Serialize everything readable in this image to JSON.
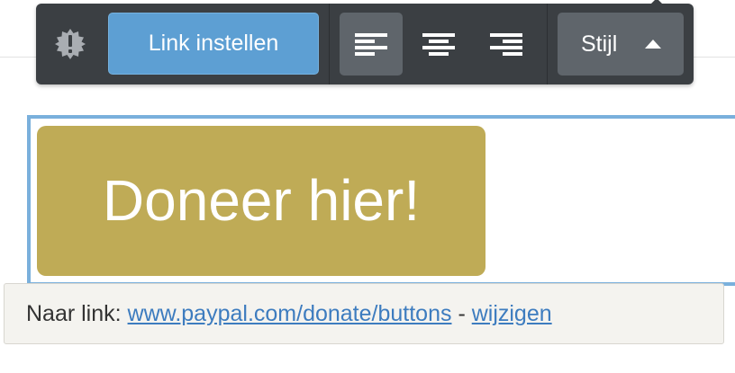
{
  "toolbar": {
    "warning_icon": "warning-badge-icon",
    "link_button_label": "Link instellen",
    "align_buttons": [
      {
        "name": "align-left",
        "icon": "align-left-icon",
        "active": true
      },
      {
        "name": "align-center",
        "icon": "align-center-icon",
        "active": false
      },
      {
        "name": "align-right",
        "icon": "align-right-icon",
        "active": false
      }
    ],
    "style_button_label": "Stijl",
    "style_button_icon": "caret-up-icon"
  },
  "editor": {
    "donate_button_label": "Doneer hier!",
    "donate_color": "#bfab56"
  },
  "link_bar": {
    "prefix": "Naar link:",
    "url": "www.paypal.com/donate/buttons",
    "separator": "-",
    "edit_label": "wijzigen"
  },
  "colors": {
    "toolbar_bg": "#3b3f43",
    "accent_blue": "#5d9fd3",
    "editor_border": "#7ab0dc",
    "link_color": "#3d7cbf"
  }
}
